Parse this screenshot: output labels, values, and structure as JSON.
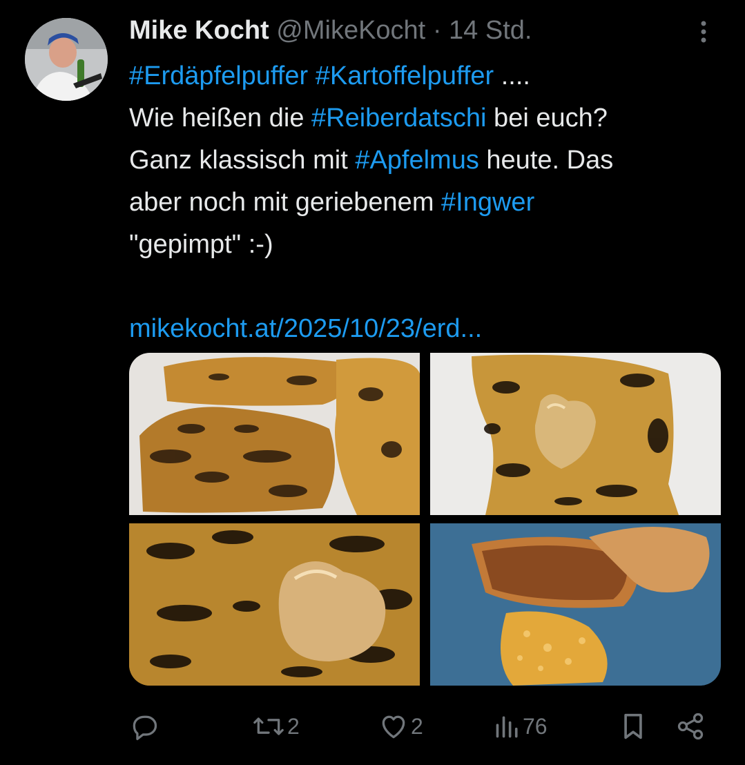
{
  "user": {
    "display_name": "Mike Kocht",
    "handle": "@MikeKocht",
    "separator": "·",
    "time": "14 Std."
  },
  "tweet": {
    "line1": {
      "tag1": "#Erdäpfelpuffer",
      "tag2": "#Kartoffelpuffer",
      "tail": " ...."
    },
    "line2": {
      "pre": "Wie heißen die ",
      "tag": "#Reiberdatschi",
      "post": " bei euch?"
    },
    "line3": {
      "pre": "Ganz klassisch mit ",
      "tag": "#Apfelmus",
      "post": " heute. Das"
    },
    "line4": {
      "pre": "aber noch mit geriebenem ",
      "tag": "#Ingwer"
    },
    "line5": "\"gepimpt\" :-)",
    "link": "mikekocht.at/2025/10/23/erd..."
  },
  "media": [
    {
      "icon": "potato-pancakes-photo"
    },
    {
      "icon": "pancake-with-applesauce-photo"
    },
    {
      "icon": "pancake-applesauce-closeup-photo"
    },
    {
      "icon": "grated-ginger-photo"
    }
  ],
  "actions": {
    "reply": {
      "icon": "reply-icon",
      "count": ""
    },
    "retweet": {
      "icon": "retweet-icon",
      "count": "2"
    },
    "like": {
      "icon": "heart-icon",
      "count": "2"
    },
    "views": {
      "icon": "views-icon",
      "count": "76"
    },
    "bookmark": {
      "icon": "bookmark-icon"
    },
    "share": {
      "icon": "share-icon"
    }
  },
  "colors": {
    "background": "#000000",
    "text": "#e7e9ea",
    "secondary": "#71767b",
    "link": "#1d9bf0"
  }
}
